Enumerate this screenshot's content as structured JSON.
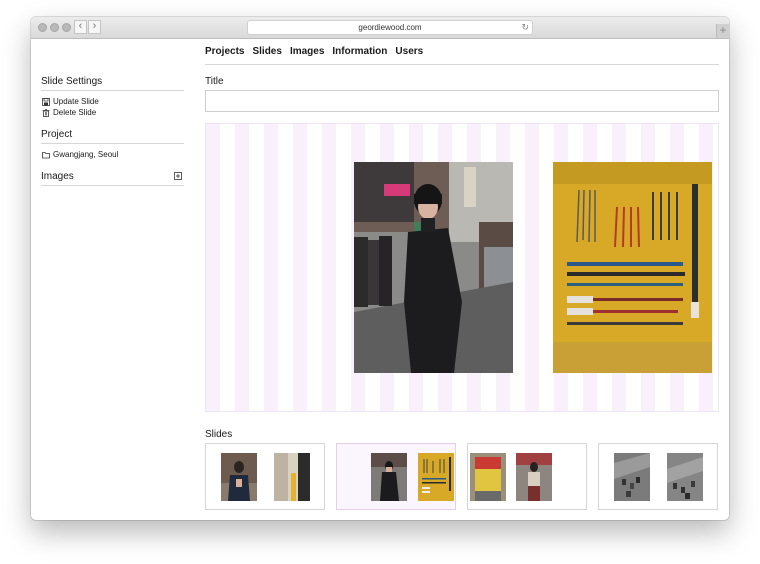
{
  "browser": {
    "url": "geordiewood.com"
  },
  "topnav": {
    "items": [
      "Projects",
      "Slides",
      "Images",
      "Information",
      "Users"
    ]
  },
  "sidebar": {
    "slide_settings_title": "Slide Settings",
    "update_slide": "Update Slide",
    "delete_slide": "Delete Slide",
    "project_title": "Project",
    "project_name": "Gwangjang, Seoul",
    "images_title": "Images"
  },
  "main": {
    "title_label": "Title",
    "title_value": "",
    "slides_label": "Slides",
    "active_slide_index": 1
  }
}
